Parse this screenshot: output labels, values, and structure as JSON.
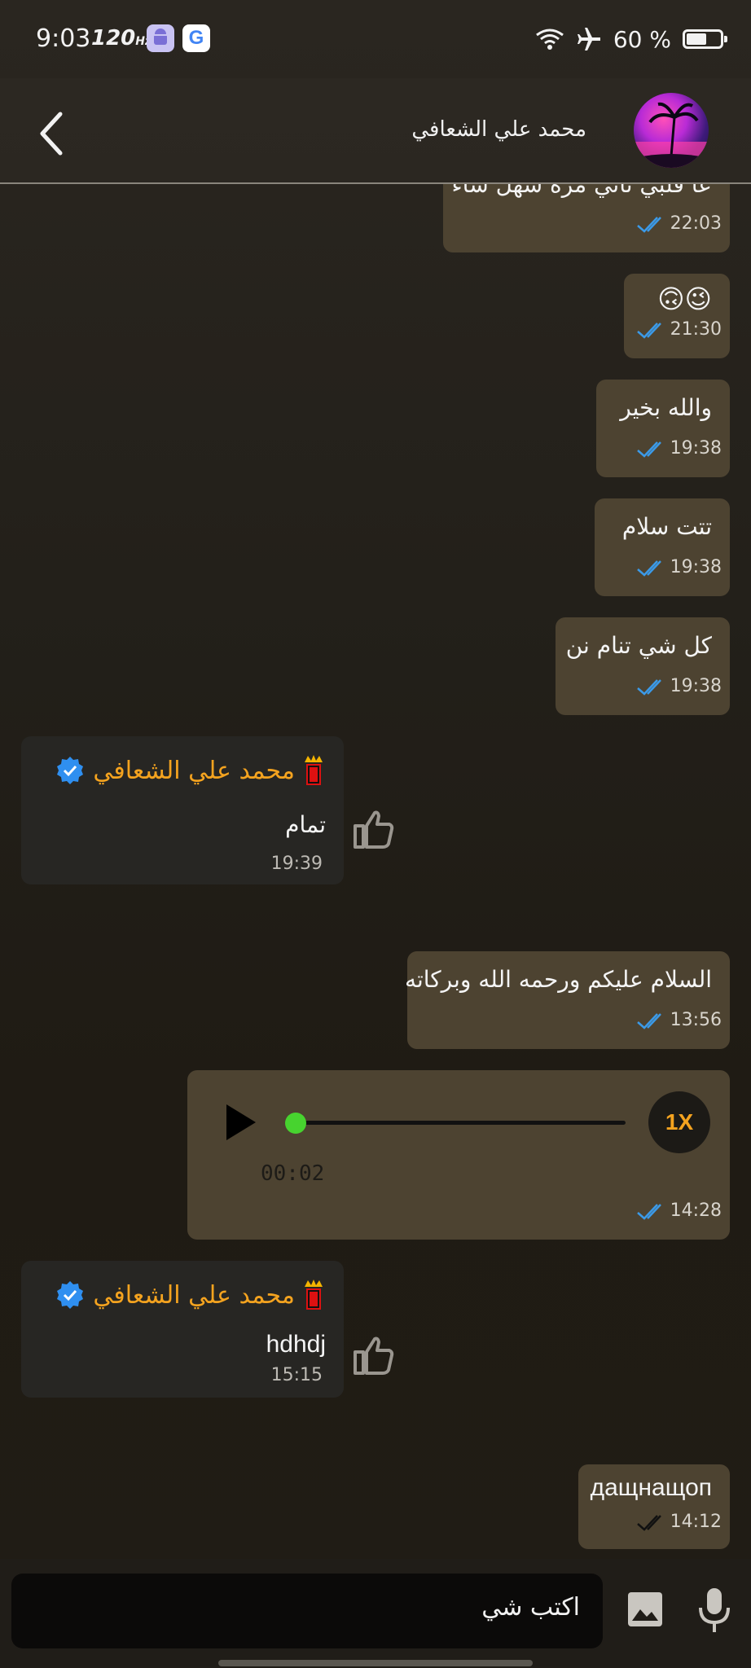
{
  "status_bar": {
    "time": "9:03",
    "refresh_rate": "120",
    "refresh_unit": "Hz",
    "battery_text": "60 %",
    "battery_level": 0.6
  },
  "header": {
    "contact_name": "محمد علي الشعافي"
  },
  "messages": [
    {
      "text": "عا قلبي تاني مرة سهل شاء",
      "time": "22:03",
      "read": true
    },
    {
      "text": "😉🙃",
      "time": "21:30",
      "read": true
    },
    {
      "text": "والله  بخير",
      "time": "19:38",
      "read": true
    },
    {
      "text": "تتت  سلام",
      "time": "19:38",
      "read": true
    },
    {
      "text": "كل  شي تنام نن",
      "time": "19:38",
      "read": true
    },
    {
      "sender": "محمد علي الشعافي",
      "text": "تمام",
      "time": "19:39"
    },
    {
      "text": "السلام عليكم ورحمه الله وبركاته",
      "time": "13:56",
      "read": true
    },
    {
      "type": "voice",
      "speed": "1X",
      "duration": "00:02",
      "time": "14:28",
      "progress": 0,
      "read": true
    },
    {
      "sender": "محمد علي الشعافي",
      "text": "hdhdj",
      "time": "15:15"
    },
    {
      "text": "дащнащоп",
      "time": "14:12",
      "read": false
    }
  ],
  "composer": {
    "placeholder": "اكتب شي"
  },
  "colors": {
    "outgoing_bubble": "#4d4331",
    "incoming_bubble": "#272623",
    "sender_name": "#f4a31f",
    "read_tick": "#3b9ae8",
    "voice_progress": "#47d32f"
  },
  "icons": [
    "back-arrow-icon",
    "wifi-icon",
    "airplane-icon",
    "battery-icon",
    "thumbs-up-icon",
    "play-icon",
    "verified-badge-icon",
    "crown-badge-icon",
    "image-icon",
    "mic-icon",
    "double-check-icon"
  ]
}
